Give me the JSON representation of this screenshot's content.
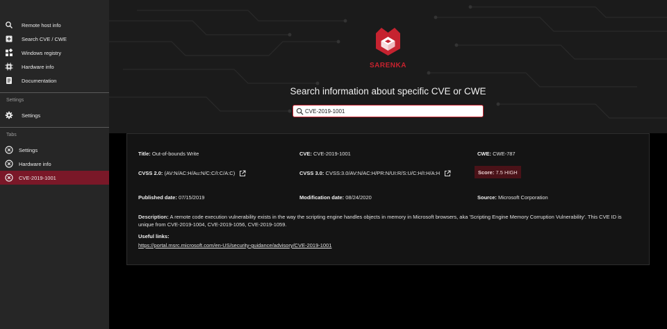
{
  "sidebar": {
    "nav_items": [
      {
        "label": "Remote host info",
        "icon": "search-icon"
      },
      {
        "label": "Search CVE / CWE",
        "icon": "add-box-icon"
      },
      {
        "label": "Windows registry",
        "icon": "widgets-icon"
      },
      {
        "label": "Hardware info",
        "icon": "chip-icon"
      },
      {
        "label": "Documentation",
        "icon": "document-icon"
      }
    ],
    "settings_section_title": "Settings",
    "settings_item": {
      "label": "Settings",
      "icon": "gear-icon"
    },
    "tabs_section_title": "Tabs",
    "tabs": [
      {
        "label": "Settings",
        "icon": "close-circle-icon",
        "active": false
      },
      {
        "label": "Hardware info",
        "icon": "close-circle-icon",
        "active": false
      },
      {
        "label": "CVE-2019-1001",
        "icon": "close-circle-icon",
        "active": true
      }
    ]
  },
  "hero": {
    "brand": "SARENKA",
    "title": "Search information about specific CVE or CWE",
    "search_value": "CVE-2019-1001"
  },
  "details": {
    "title_label": "Title:",
    "title_value": "Out-of-bounds Write",
    "cve_label": "CVE:",
    "cve_value": "CVE-2019-1001",
    "cwe_label": "CWE:",
    "cwe_value": "CWE-787",
    "cvss2_label": "CVSS 2.0:",
    "cvss2_value": "(AV:N/AC:H/Au:N/C:C/I:C/A:C)",
    "cvss3_label": "CVSS 3.0:",
    "cvss3_value": "CVSS:3.0/AV:N/AC:H/PR:N/UI:R/S:U/C:H/I:H/A:H",
    "score_label": "Score:",
    "score_value": "7.5 HIGH",
    "published_label": "Published date:",
    "published_value": "07/15/2019",
    "modification_label": "Modification date:",
    "modification_value": "08/24/2020",
    "source_label": "Source:",
    "source_value": "Microsoft Corporation",
    "description_label": "Description:",
    "description_value": "A remote code execution vulnerability exists in the way the scripting engine handles objects in memory in Microsoft browsers, aka 'Scripting Engine Memory Corruption Vulnerability'. This CVE ID is unique from CVE-2019-1004, CVE-2019-1056, CVE-2019-1059.",
    "useful_links_label": "Useful links:",
    "useful_link": "https://portal.msrc.microsoft.com/en-US/security-guidance/advisory/CVE-2019-1001"
  },
  "colors": {
    "accent": "#c62330",
    "active_tab": "#7a1828",
    "sidebar_bg": "#262626",
    "score_bg": "#4a1218"
  }
}
